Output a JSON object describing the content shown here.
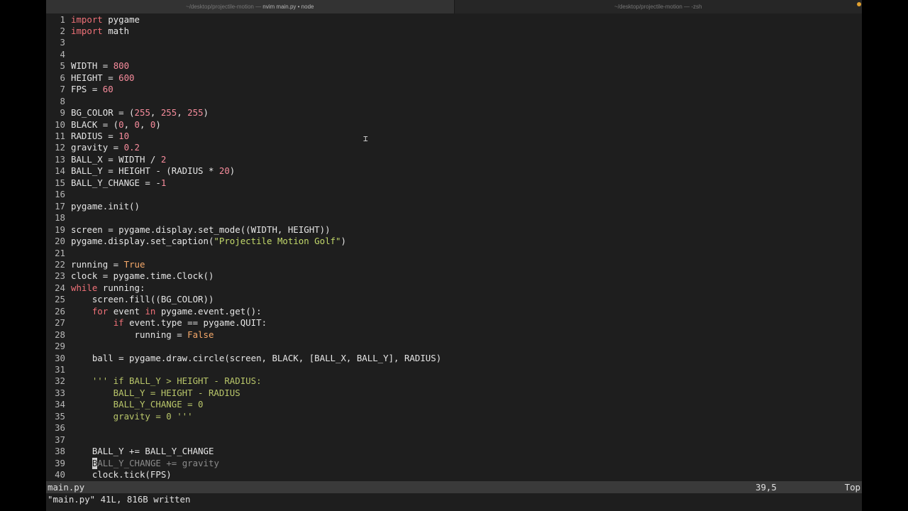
{
  "tabs": [
    {
      "path": "~/desktop/projectile-motion — ",
      "title": "nvim main.py • node",
      "active": true
    },
    {
      "path": "~/desktop/projectile-motion — ",
      "title": "-zsh",
      "active": false
    }
  ],
  "editor": {
    "lines": [
      {
        "n": "1",
        "tokens": [
          [
            "kw",
            "import"
          ],
          [
            "code",
            " pygame"
          ]
        ]
      },
      {
        "n": "2",
        "tokens": [
          [
            "kw",
            "import"
          ],
          [
            "code",
            " math"
          ]
        ]
      },
      {
        "n": "3",
        "tokens": []
      },
      {
        "n": "4",
        "tokens": []
      },
      {
        "n": "5",
        "tokens": [
          [
            "code",
            "WIDTH = "
          ],
          [
            "num",
            "800"
          ]
        ]
      },
      {
        "n": "6",
        "tokens": [
          [
            "code",
            "HEIGHT = "
          ],
          [
            "num",
            "600"
          ]
        ]
      },
      {
        "n": "7",
        "tokens": [
          [
            "code",
            "FPS = "
          ],
          [
            "num",
            "60"
          ]
        ]
      },
      {
        "n": "8",
        "tokens": []
      },
      {
        "n": "9",
        "tokens": [
          [
            "code",
            "BG_COLOR = ("
          ],
          [
            "num",
            "255"
          ],
          [
            "code",
            ", "
          ],
          [
            "num",
            "255"
          ],
          [
            "code",
            ", "
          ],
          [
            "num",
            "255"
          ],
          [
            "code",
            ")"
          ]
        ]
      },
      {
        "n": "10",
        "tokens": [
          [
            "code",
            "BLACK = ("
          ],
          [
            "num",
            "0"
          ],
          [
            "code",
            ", "
          ],
          [
            "num",
            "0"
          ],
          [
            "code",
            ", "
          ],
          [
            "num",
            "0"
          ],
          [
            "code",
            ")"
          ]
        ]
      },
      {
        "n": "11",
        "tokens": [
          [
            "code",
            "RADIUS = "
          ],
          [
            "num",
            "10"
          ]
        ]
      },
      {
        "n": "12",
        "tokens": [
          [
            "code",
            "gravity = "
          ],
          [
            "num",
            "0.2"
          ]
        ]
      },
      {
        "n": "13",
        "tokens": [
          [
            "code",
            "BALL_X = WIDTH / "
          ],
          [
            "num",
            "2"
          ]
        ]
      },
      {
        "n": "14",
        "tokens": [
          [
            "code",
            "BALL_Y = HEIGHT - (RADIUS * "
          ],
          [
            "num",
            "20"
          ],
          [
            "code",
            ")"
          ]
        ]
      },
      {
        "n": "15",
        "tokens": [
          [
            "code",
            "BALL_Y_CHANGE = -"
          ],
          [
            "num",
            "1"
          ]
        ]
      },
      {
        "n": "16",
        "tokens": []
      },
      {
        "n": "17",
        "tokens": [
          [
            "code",
            "pygame.init()"
          ]
        ]
      },
      {
        "n": "18",
        "tokens": []
      },
      {
        "n": "19",
        "tokens": [
          [
            "code",
            "screen = pygame.display.set_mode((WIDTH, HEIGHT))"
          ]
        ]
      },
      {
        "n": "20",
        "tokens": [
          [
            "code",
            "pygame.display.set_caption("
          ],
          [
            "str",
            "\"Projectile Motion Golf\""
          ],
          [
            "code",
            ")"
          ]
        ]
      },
      {
        "n": "21",
        "tokens": []
      },
      {
        "n": "22",
        "tokens": [
          [
            "code",
            "running = "
          ],
          [
            "ctl",
            "True"
          ]
        ]
      },
      {
        "n": "23",
        "tokens": [
          [
            "code",
            "clock = pygame.time.Clock()"
          ]
        ]
      },
      {
        "n": "24",
        "tokens": [
          [
            "kw",
            "while"
          ],
          [
            "code",
            " running:"
          ]
        ]
      },
      {
        "n": "25",
        "tokens": [
          [
            "code",
            "    screen.fill((BG_COLOR))"
          ]
        ]
      },
      {
        "n": "26",
        "tokens": [
          [
            "code",
            "    "
          ],
          [
            "kw",
            "for"
          ],
          [
            "code",
            " event "
          ],
          [
            "kw",
            "in"
          ],
          [
            "code",
            " pygame.event.get():"
          ]
        ]
      },
      {
        "n": "27",
        "tokens": [
          [
            "code",
            "        "
          ],
          [
            "kw",
            "if"
          ],
          [
            "code",
            " event.type == pygame.QUIT:"
          ]
        ]
      },
      {
        "n": "28",
        "tokens": [
          [
            "code",
            "            running = "
          ],
          [
            "ctl",
            "False"
          ]
        ]
      },
      {
        "n": "29",
        "tokens": []
      },
      {
        "n": "30",
        "tokens": [
          [
            "code",
            "    ball = pygame.draw.circle(screen, BLACK, [BALL_X, BALL_Y], RADIUS)"
          ]
        ]
      },
      {
        "n": "31",
        "tokens": []
      },
      {
        "n": "32",
        "tokens": [
          [
            "code",
            "    "
          ],
          [
            "doc",
            "''' if BALL_Y > HEIGHT - RADIUS:"
          ]
        ]
      },
      {
        "n": "33",
        "tokens": [
          [
            "doc",
            "        BALL_Y = HEIGHT - RADIUS"
          ]
        ]
      },
      {
        "n": "34",
        "tokens": [
          [
            "doc",
            "        BALL_Y_CHANGE = 0"
          ]
        ]
      },
      {
        "n": "35",
        "tokens": [
          [
            "doc",
            "        gravity = 0 '''"
          ]
        ]
      },
      {
        "n": "36",
        "tokens": []
      },
      {
        "n": "37",
        "tokens": []
      },
      {
        "n": "38",
        "tokens": [
          [
            "code",
            "    BALL_Y += BALL_Y_CHANGE"
          ]
        ]
      },
      {
        "n": "39",
        "tokens": [
          [
            "code",
            "    "
          ],
          [
            "cursor",
            "B"
          ],
          [
            "dim",
            "ALL_Y_CHANGE += gravity"
          ]
        ]
      },
      {
        "n": "40",
        "tokens": [
          [
            "code",
            "    clock.tick(FPS)"
          ]
        ]
      }
    ]
  },
  "statusline": {
    "filename": "main.py",
    "position": "39,5",
    "scroll": "Top"
  },
  "cmdline": {
    "message": "\"main.py\" 41L, 816B written"
  },
  "icons": {
    "mouse_cursor": "text-cursor-icon",
    "recording": "recording-dot-icon"
  }
}
